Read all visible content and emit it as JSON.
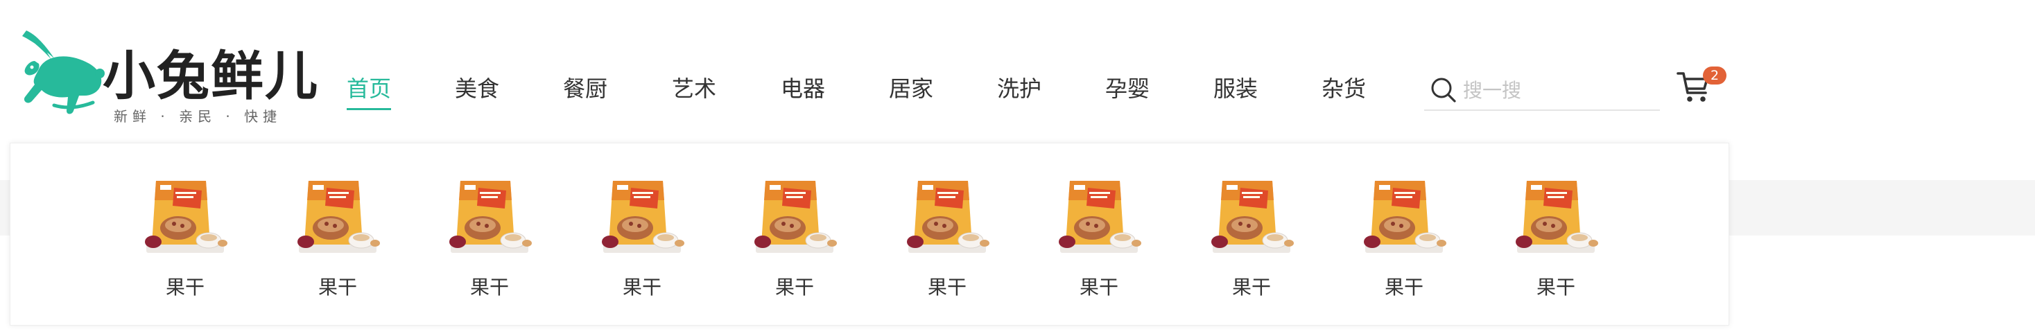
{
  "logo": {
    "name": "小兔鲜儿",
    "slogan": "新鲜 · 亲民 · 快捷",
    "icon": "rabbit-logo-icon"
  },
  "nav": {
    "items": [
      {
        "label": "首页",
        "active": true
      },
      {
        "label": "美食",
        "active": false
      },
      {
        "label": "餐厨",
        "active": false
      },
      {
        "label": "艺术",
        "active": false
      },
      {
        "label": "电器",
        "active": false
      },
      {
        "label": "居家",
        "active": false
      },
      {
        "label": "洗护",
        "active": false
      },
      {
        "label": "孕婴",
        "active": false
      },
      {
        "label": "服装",
        "active": false
      },
      {
        "label": "杂货",
        "active": false
      }
    ]
  },
  "search": {
    "placeholder": "搜一搜",
    "value": "",
    "icon": "search-icon"
  },
  "cart": {
    "count": "2",
    "icon": "cart-icon"
  },
  "dropdown": {
    "items": [
      {
        "name": "果干"
      },
      {
        "name": "果干"
      },
      {
        "name": "果干"
      },
      {
        "name": "果干"
      },
      {
        "name": "果干"
      },
      {
        "name": "果干"
      },
      {
        "name": "果干"
      },
      {
        "name": "果干"
      },
      {
        "name": "果干"
      },
      {
        "name": "果干"
      }
    ]
  },
  "colors": {
    "brand": "#27ba9b",
    "badge": "#e26237",
    "text": "#333333",
    "placeholder": "#c4c4c4"
  }
}
